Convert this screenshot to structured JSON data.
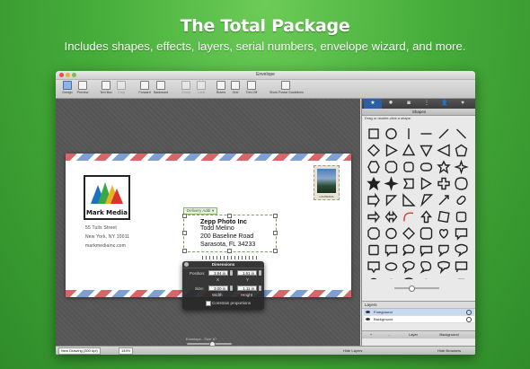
{
  "hero": {
    "title": "The Total Package",
    "subtitle": "Includes shapes, effects, layers, serial numbers, envelope wizard, and more."
  },
  "window": {
    "title": "Envelope"
  },
  "toolbar": {
    "design": "Design",
    "preview": "Preview",
    "text_box": "Text Box",
    "crop": "Crop",
    "forward": "Forward",
    "backward": "Backward",
    "group": "Group",
    "lock": "Lock",
    "rulers": "Rulers",
    "grid": "Grid",
    "trim_off": "Trim Off",
    "postal_guidelines": "Show Postal Guidelines"
  },
  "envelope": {
    "logo_text": "Mark Media",
    "return_address": [
      "55 Tulls Street",
      "New York, NY 10011",
      "markmediainc.com"
    ],
    "delivery_tag": "Delivery Addr ▾",
    "recipient": [
      "Zepp Photo Inc",
      "Todd Melino",
      "200 Baseline Road",
      "Sarasota, FL 34233"
    ],
    "stamp_caption": "LOUISIANA"
  },
  "dimensions": {
    "title": "Dimensions",
    "position_label": "Position:",
    "pos_x": "3.94 in",
    "pos_y": "1.61 in",
    "x_label": "X",
    "y_label": "Y",
    "size_label": "Size:",
    "width": "3.00 in",
    "height": "1.11 in",
    "width_label": "Width",
    "height_label": "Height",
    "constrain": "Constrain proportions"
  },
  "canvas": {
    "caption": "Envelope - Size 10"
  },
  "statusbar": {
    "drawing": "New Drawing (300 dpi)",
    "zoom": "144%",
    "hide_layers": "Hide Layers",
    "hide_browsers": "Hide Browsers"
  },
  "sidebar": {
    "tabs": [
      "star-icon",
      "gear-icon",
      "camera-icon",
      "more-icon",
      "person-icon",
      "heart-icon"
    ],
    "shapes_title": "Shapes",
    "hint": "Drag or double-click a shape.",
    "layers_title": "Layers",
    "layers": [
      "Foreground",
      "Background"
    ],
    "layer_tools": [
      "+",
      "-",
      "Layer",
      "Background"
    ]
  },
  "colors": {
    "background_green": "#46ad3a",
    "selected_tab": "#2e5fa4",
    "airmail_red": "#d9656b",
    "airmail_blue": "#7e9fd4"
  }
}
